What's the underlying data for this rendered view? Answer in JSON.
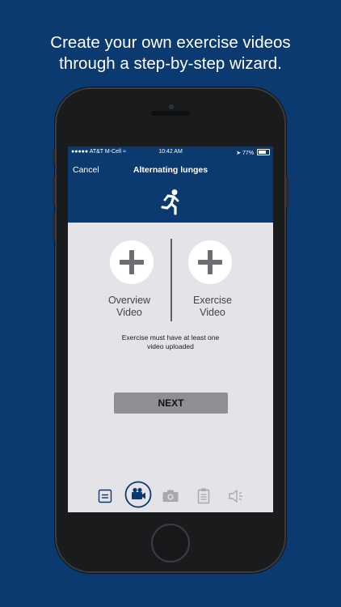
{
  "headline": {
    "line1": "Create your own exercise videos",
    "line2": "through a step-by-step wizard."
  },
  "status_bar": {
    "carrier": "●●●●● AT&T M-Cell",
    "time": "10:42 AM",
    "battery": "77%"
  },
  "nav": {
    "cancel_label": "Cancel",
    "title": "Alternating lunges"
  },
  "hero_icon": "running-person-icon",
  "videos": {
    "overview": {
      "line1": "Overview",
      "line2": "Video"
    },
    "exercise": {
      "line1": "Exercise",
      "line2": "Video"
    }
  },
  "notice": {
    "line1": "Exercise must have at least one",
    "line2": "video uploaded"
  },
  "next_label": "NEXT",
  "tabs": [
    {
      "icon": "notes-icon",
      "active": false
    },
    {
      "icon": "video-camera-icon",
      "active": true
    },
    {
      "icon": "photo-camera-icon",
      "active": false
    },
    {
      "icon": "clipboard-icon",
      "active": false
    },
    {
      "icon": "speaker-icon",
      "active": false
    }
  ],
  "colors": {
    "brand_blue": "#0b3a70",
    "screen_bg": "#e3e3e8",
    "button_gray": "#8f8f93"
  }
}
